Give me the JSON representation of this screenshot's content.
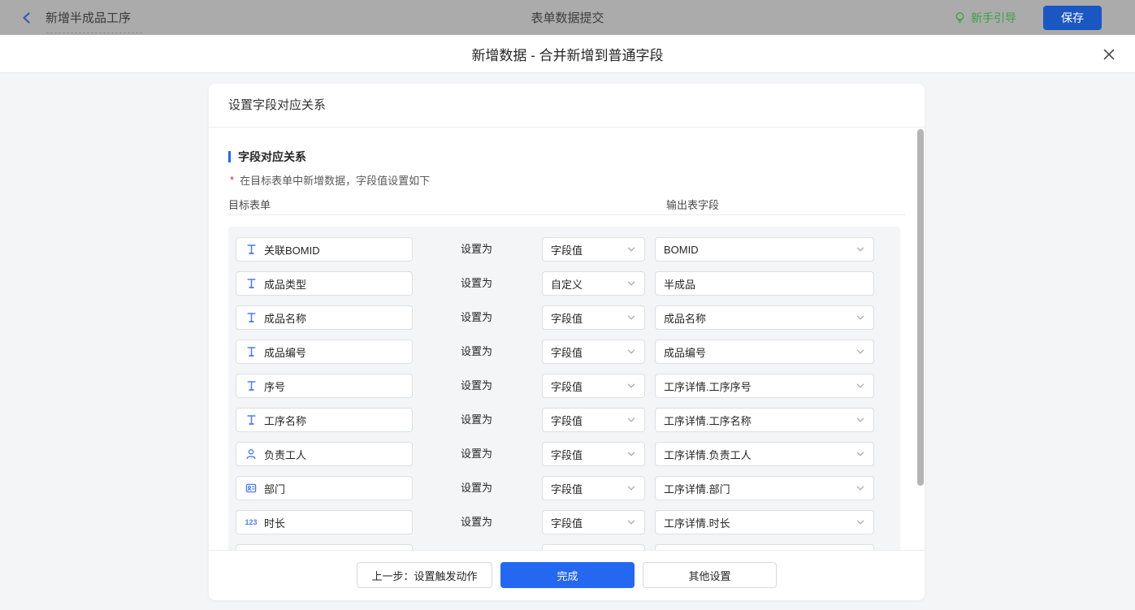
{
  "topbar": {
    "back_label": "新增半成品工序",
    "center_title": "表单数据提交",
    "guide_label": "新手引导",
    "save_label": "保存"
  },
  "modal": {
    "title": "新增数据 - 合并新增到普通字段",
    "card_header": "设置字段对应关系",
    "section_title": "字段对应关系",
    "required_mark": "*",
    "section_desc": "在目标表单中新增数据，字段值设置如下",
    "col_left": "目标表单",
    "col_right": "输出表字段",
    "set_as_label": "设置为",
    "rows": [
      {
        "field": "关联BOMID",
        "icon": "text-field-icon",
        "mode": "字段值",
        "mode_select": true,
        "value": "BOMID",
        "value_select": true
      },
      {
        "field": "成品类型",
        "icon": "text-field-icon",
        "mode": "自定义",
        "mode_select": true,
        "value": "半成品",
        "value_select": false
      },
      {
        "field": "成品名称",
        "icon": "text-field-icon",
        "mode": "字段值",
        "mode_select": true,
        "value": "成品名称",
        "value_select": true
      },
      {
        "field": "成品编号",
        "icon": "text-field-icon",
        "mode": "字段值",
        "mode_select": true,
        "value": "成品编号",
        "value_select": true
      },
      {
        "field": "序号",
        "icon": "text-field-icon",
        "mode": "字段值",
        "mode_select": true,
        "value": "工序详情.工序序号",
        "value_select": true
      },
      {
        "field": "工序名称",
        "icon": "text-field-icon",
        "mode": "字段值",
        "mode_select": true,
        "value": "工序详情.工序名称",
        "value_select": true
      },
      {
        "field": "负责工人",
        "icon": "user-icon",
        "mode": "字段值",
        "mode_select": true,
        "value": "工序详情.负责工人",
        "value_select": true
      },
      {
        "field": "部门",
        "icon": "department-icon",
        "mode": "字段值",
        "mode_select": true,
        "value": "工序详情.部门",
        "value_select": true
      },
      {
        "field": "时长",
        "icon": "number-icon",
        "mode": "字段值",
        "mode_select": true,
        "value": "工序详情.时长",
        "value_select": true
      },
      {
        "field": "",
        "icon": "none",
        "mode": "",
        "mode_select": false,
        "value": "",
        "value_select": false
      }
    ],
    "footer": {
      "prev_label": "上一步：设置触发动作",
      "done_label": "完成",
      "other_label": "其他设置"
    }
  },
  "colors": {
    "primary_blue": "#2468f2",
    "save_button_blue": "#1b57c2",
    "guide_green": "#37a33f",
    "topbar_dimmed_bg": "#ababab",
    "field_icon_blue": "#4a7cfa",
    "required_red": "#f5222d",
    "panel_bg": "#f4f5f7"
  }
}
